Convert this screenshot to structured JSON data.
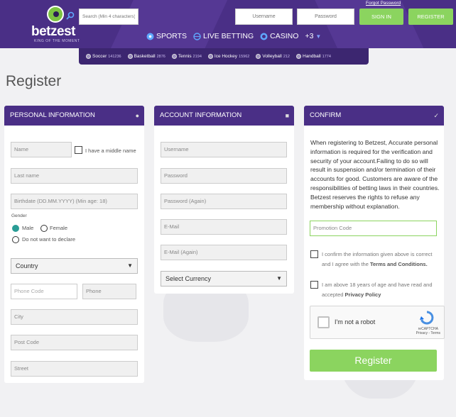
{
  "header": {
    "logo_name": "betzest",
    "logo_tagline": "KING OF THE MOMENT",
    "search_placeholder": "Search (Min 4 characters)",
    "username_placeholder": "Username",
    "password_placeholder": "Password",
    "forgot_password": "Forgot Password",
    "sign_in": "SIGN IN",
    "register": "REGISTER",
    "nav": [
      {
        "label": "SPORTS",
        "icon": "soccer-ball-icon"
      },
      {
        "label": "LIVE BETTING",
        "icon": "live-globe-icon"
      },
      {
        "label": "CASINO",
        "icon": "casino-chip-icon"
      }
    ],
    "nav_more": "+3"
  },
  "sports_strip": [
    {
      "label": "Soccer",
      "count": "141236"
    },
    {
      "label": "Basketball",
      "count": "2876"
    },
    {
      "label": "Tennis",
      "count": "2194"
    },
    {
      "label": "Ice Hockey",
      "count": "15962"
    },
    {
      "label": "Volleyball",
      "count": "212"
    },
    {
      "label": "Handball",
      "count": "1774"
    }
  ],
  "page_title": "Register",
  "personal": {
    "title": "PERSONAL INFORMATION",
    "name": "Name",
    "middle_name": "I have a middle name",
    "last_name": "Last name",
    "birthdate": "Birthdate (DD.MM.YYYY) (Min age: 18)",
    "gender_label": "Gender",
    "male": "Male",
    "female": "Female",
    "no_declare": "Do not want to declare",
    "country": "Country",
    "phone_code": "Phone Code",
    "phone": "Phone",
    "city": "City",
    "post_code": "Post Code",
    "street": "Street"
  },
  "account": {
    "title": "ACCOUNT INFORMATION",
    "username": "Username",
    "password": "Password",
    "password_again": "Password (Again)",
    "email": "E-Mail",
    "email_again": "E-Mail (Again)",
    "currency": "Select Currency"
  },
  "confirm": {
    "title": "CONFIRM",
    "text": "When registering to Betzest, Accurate personal information is required for the verification and security of your account.Failing to do so will result in suspension and/or termination of their accounts for good. Customers are aware of the responsibilities of betting laws in their countries. Betzest reserves the rights to refuse any membership without explanation.",
    "promo": "Promotion Code",
    "terms_pre": "I confirm the information given above is correct and I agree with the ",
    "terms_link": "Terms and Conditions.",
    "age_pre": "I am above 18 years of age and have read and accepted ",
    "age_link": "Privacy Policy",
    "captcha_label": "I'm not a robot",
    "captcha_brand": "reCAPTCHA",
    "captcha_links": "Privacy - Terms",
    "register_button": "Register"
  },
  "colors": {
    "header": "#4a2f86",
    "accent_green": "#8bd45f",
    "teal": "#2a9d96"
  }
}
